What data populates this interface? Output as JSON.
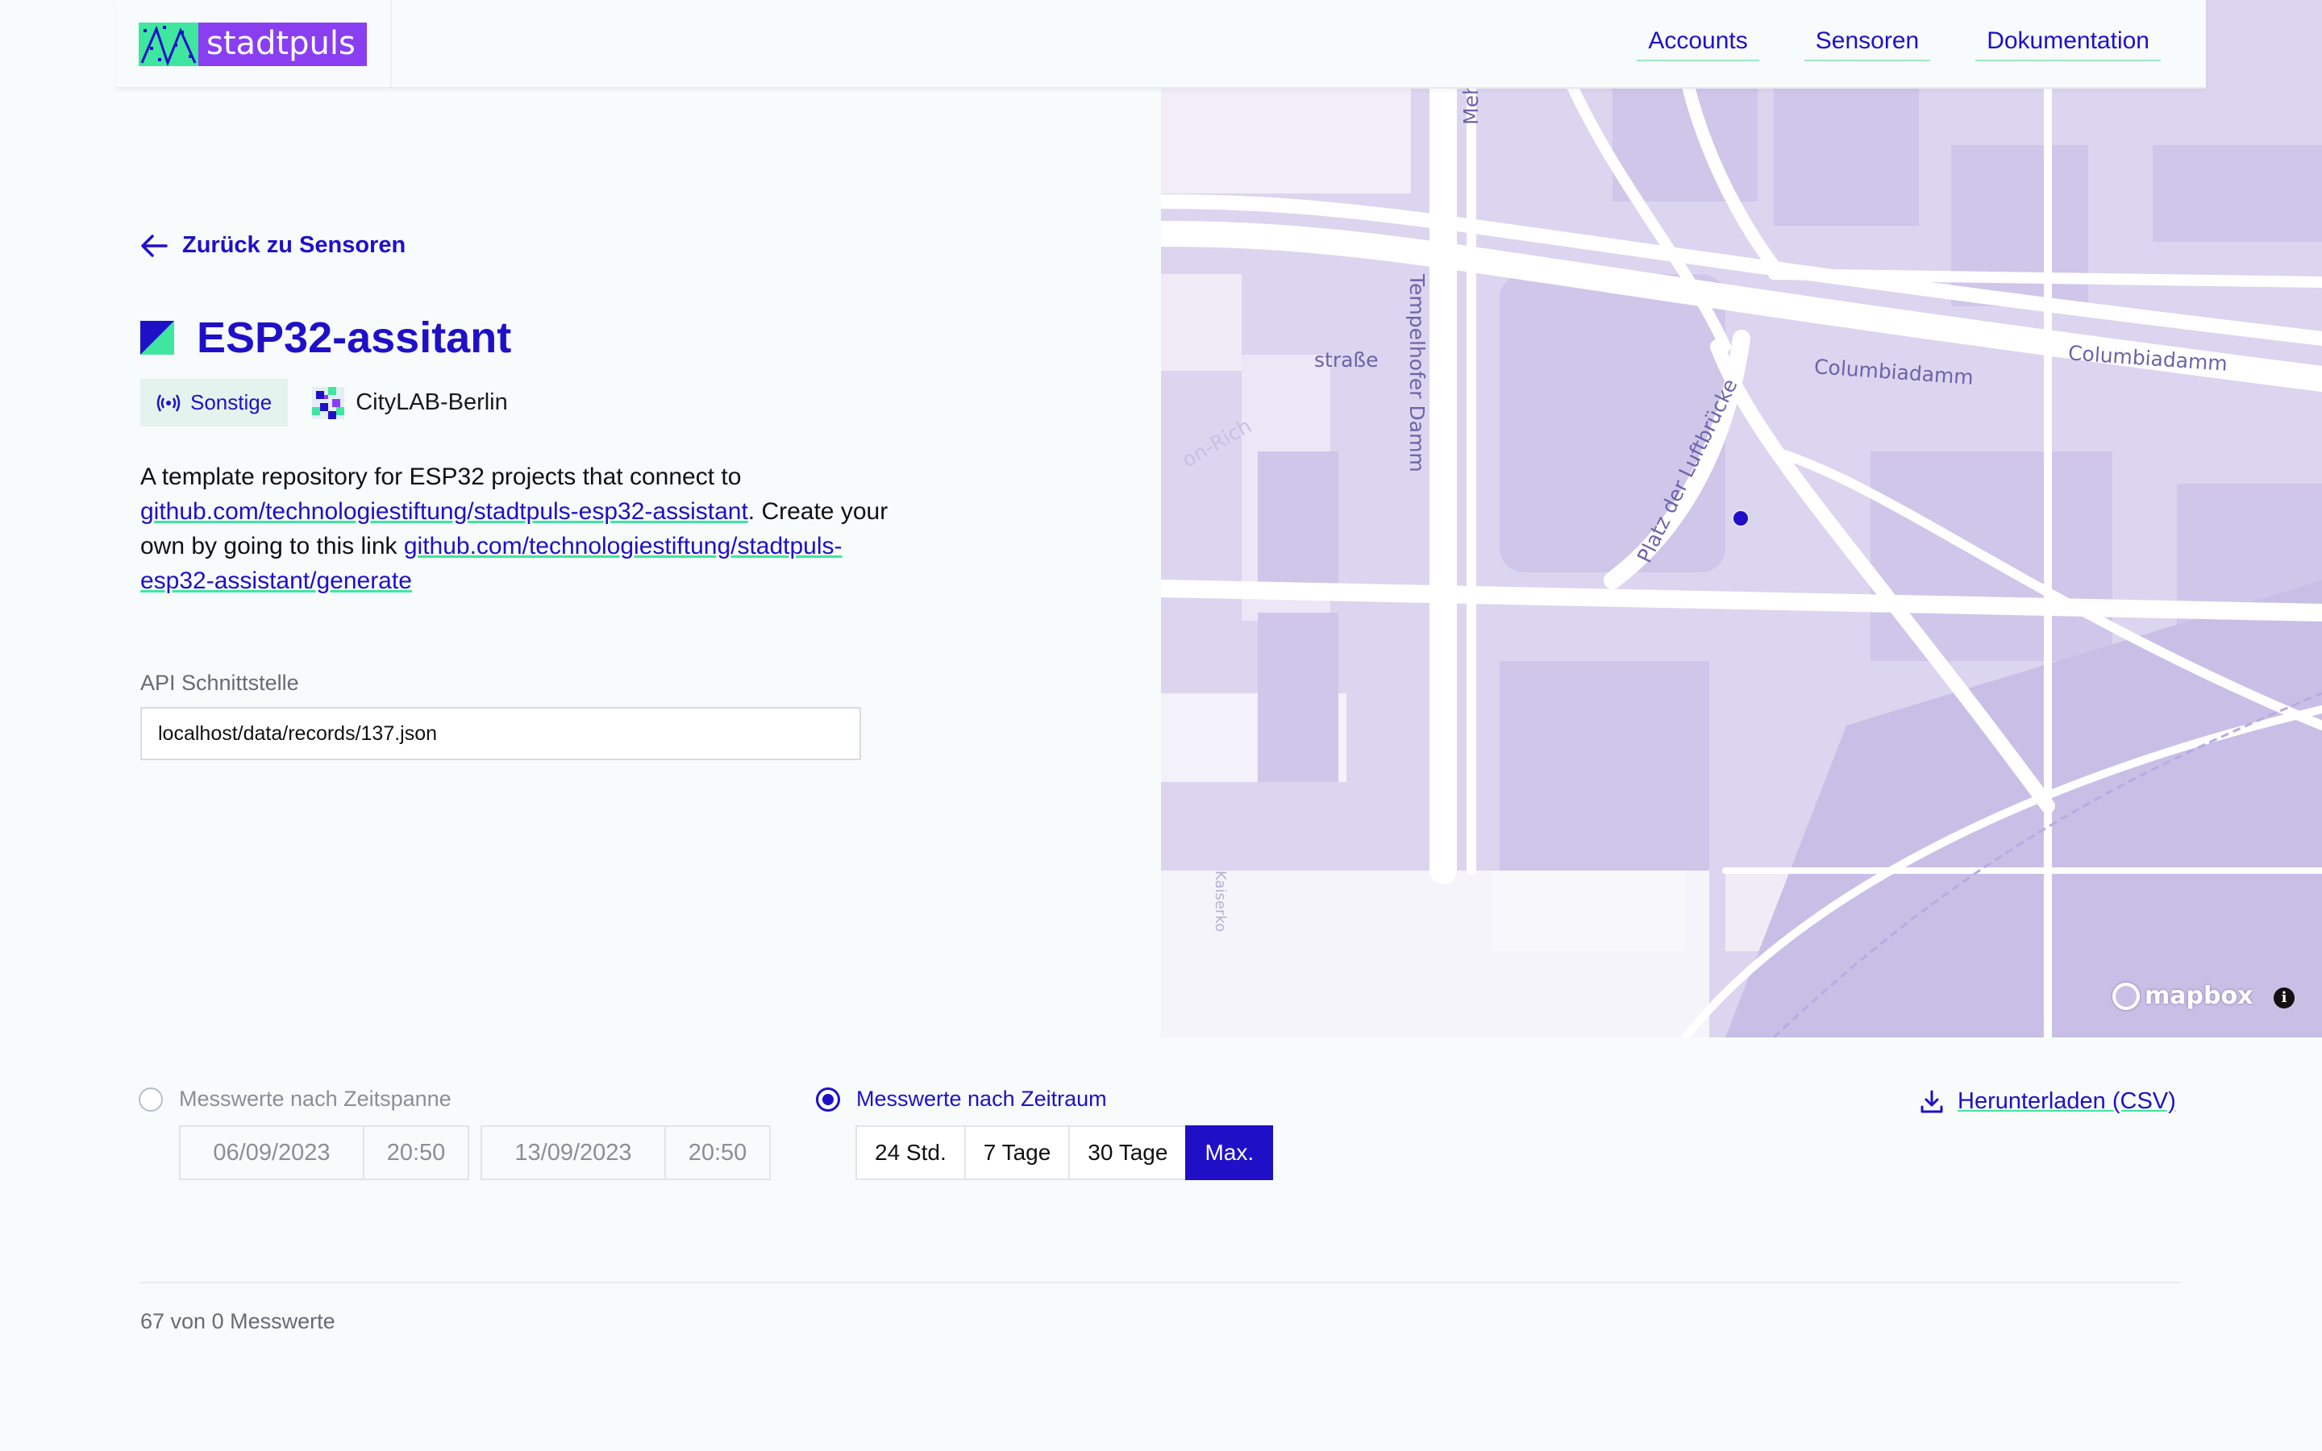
{
  "header": {
    "logo_text": "stadtpuls",
    "nav": [
      {
        "label": "Accounts"
      },
      {
        "label": "Sensoren"
      },
      {
        "label": "Dokumentation"
      }
    ]
  },
  "back_link": {
    "label": "Zurück zu Sensoren",
    "icon": "arrow-left-icon"
  },
  "sensor": {
    "title": "ESP32-assitant",
    "category": "Sonstige",
    "category_icon": "broadcast-icon",
    "owner": "CityLAB-Berlin",
    "description": {
      "text1": "A template repository for ESP32 projects that connect to ",
      "link1": "github.com/technologiestiftung/stadtpuls-esp32-assistant",
      "text2": ". Create your own by going to this link ",
      "link2": "github.com/technologiestiftung/stadtpuls-esp32-assistant/generate"
    },
    "api_label": "API Schnittstelle",
    "api_value": "localhost/data/records/137.json"
  },
  "map": {
    "streets": [
      "Mehring",
      "Tempelhofer Damm",
      "Columbiadamm",
      "Columbiadamm",
      "Platz der Luftbrücke",
      "straße",
      "on-Rich",
      "Kaiserko"
    ],
    "attribution": "mapbox",
    "info_label": "i"
  },
  "controls": {
    "mode_span_label": "Messwerte nach Zeitspanne",
    "mode_range_label": "Messwerte nach Zeitraum",
    "date_from": "06/09/2023",
    "time_from": "20:50",
    "date_to": "13/09/2023",
    "time_to": "20:50",
    "ranges": [
      "24 Std.",
      "7 Tage",
      "30 Tage",
      "Max."
    ],
    "active_range": "Max.",
    "download_label": "Herunterladen (CSV)"
  },
  "footer": {
    "count_text": "67 von 0 Messwerte"
  },
  "colors": {
    "accent": "#1f10c8",
    "brand_green": "#3ee6a0",
    "brand_purple": "#8a3ef2",
    "map_bg": "#dcd5ef"
  }
}
